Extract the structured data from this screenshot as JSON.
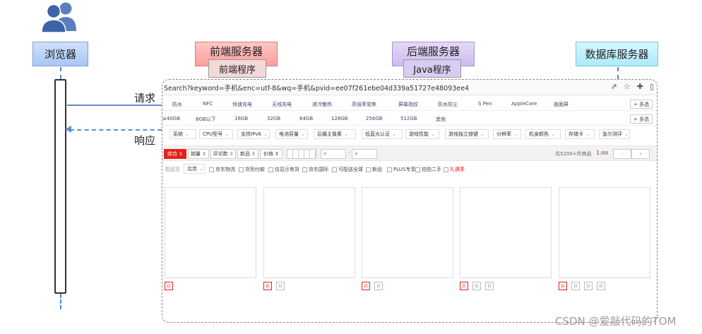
{
  "lifelines": {
    "browser": "浏览器",
    "frontend": "前端服务器",
    "frontend_sub": "前端程序",
    "backend": "后端服务器",
    "backend_sub": "Java程序",
    "database": "数据库服务器"
  },
  "messages": {
    "request": "请求",
    "response": "响应"
  },
  "browser_window": {
    "address": "Search?keyword=手机&enc=utf-8&wq=手机&pvid=ee07f261ebe04d339a51727e48093ee4",
    "feature_tags": [
      "防水",
      "NFC",
      "快速充电",
      "无线充电",
      "液冷散热",
      "高倍率变焦",
      "屏幕指纹",
      "防水防尘",
      "S Pen",
      "AppleCare",
      "曲面屏"
    ],
    "storage_tags": [
      "≤40GB",
      "8GB以下",
      "16GB",
      "32GB",
      "64GB",
      "128GB",
      "256GB",
      "512GB",
      "其他"
    ],
    "more_label": "+ 多选",
    "dropdowns": [
      "系统",
      "CPU型号",
      "支持IPv6",
      "电池容量",
      "后摄主像素",
      "低蓝光认证",
      "游戏性能",
      "游戏独立按键",
      "分辨率",
      "机身颜色",
      "存储卡",
      "急尔测评"
    ],
    "sort": {
      "buttons": [
        "综合 ⇩",
        "销量 ⇩",
        "评论数 ⇩",
        "新品 ⇩",
        "价格 ⇕"
      ],
      "price_from": "¥",
      "price_dash": "-",
      "price_to": "¥",
      "result_count": "共5200+件商品",
      "page_current": "1",
      "page_total": "/88",
      "prev": "‹",
      "next": "›"
    },
    "filters": {
      "ship_label": "配送至",
      "location": "北京",
      "options": [
        "京东物流",
        "货到付款",
        "仅显示有货",
        "京东国际",
        "可配送全球",
        "新品",
        "PLUS专享",
        "拍拍二手"
      ],
      "highlight": "礼遇季"
    },
    "thumb_glyph": "D"
  },
  "watermark": "CSDN @爱敲代码的TOM"
}
